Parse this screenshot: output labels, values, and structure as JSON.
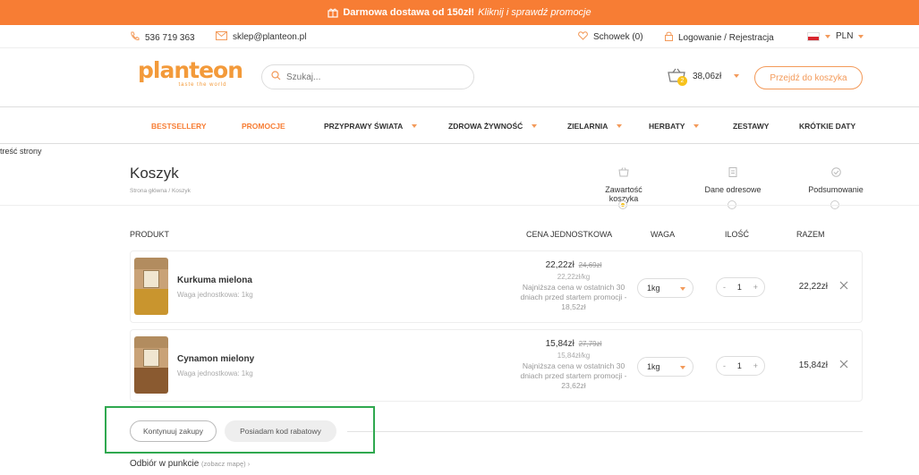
{
  "promo": {
    "bold": "Darmowa dostawa od 150zł!",
    "italic": "Kliknij i sprawdź promocje"
  },
  "contact": {
    "phone": "536 719 363",
    "email": "sklep@planteon.pl",
    "wishlist": "Schowek (0)",
    "login": "Logowanie / Rejestracja",
    "currency": "PLN"
  },
  "header": {
    "logo_word": "planteon",
    "logo_tag": "taste the world",
    "search_placeholder": "Szukaj...",
    "cart_count": "2",
    "cart_total": "38,06zł",
    "cart_button": "Przejdź do koszyka"
  },
  "nav": [
    {
      "label": "BESTSELLERY"
    },
    {
      "label": "PROMOCJE"
    },
    {
      "label": "PRZYPRAWY ŚWIATA"
    },
    {
      "label": "ZDROWA ŻYWNOŚĆ"
    },
    {
      "label": "ZIELARNIA"
    },
    {
      "label": "HERBATY"
    },
    {
      "label": "ZESTAWY"
    },
    {
      "label": "KRÓTKIE DATY"
    }
  ],
  "skip_text": "treść strony",
  "page": {
    "title": "Koszyk",
    "breadcrumb": "Strona główna  /  Koszyk"
  },
  "steps": [
    {
      "label": "Zawartość koszyka"
    },
    {
      "label": "Dane odresowe"
    },
    {
      "label": "Podsumowanie"
    }
  ],
  "columns": {
    "product": "PRODUKT",
    "unit_price": "CENA JEDNOSTKOWA",
    "weight": "WAGA",
    "qty": "ILOŚĆ",
    "total": "RAZEM"
  },
  "items": [
    {
      "name": "Kurkuma mielona",
      "unit_weight": "Waga jednostkowa: 1kg",
      "price": "22,22zł",
      "old_price": "24,69zł",
      "per_kg": "22,22zł/kg",
      "lowest": "Najniższa cena w ostatnich 30 dniach przed startem promocji - 18,52zł",
      "weight": "1kg",
      "qty": "1",
      "total": "22,22zł",
      "color": "#c9952e"
    },
    {
      "name": "Cynamon mielony",
      "unit_weight": "Waga jednostkowa: 1kg",
      "price": "15,84zł",
      "old_price": "27,79zł",
      "per_kg": "15,84zł/kg",
      "lowest": "Najniższa cena w ostatnich 30 dniach przed startem promocji - 23,62zł",
      "weight": "1kg",
      "qty": "1",
      "total": "15,84zł",
      "color": "#8a5a30"
    }
  ],
  "actions": {
    "continue": "Kontynuuj zakupy",
    "code": "Posiadam kod rabatowy"
  },
  "pickup": {
    "label": "Odbiór w punkcie",
    "map": "(zobacz mapę)"
  },
  "colors": {
    "accent": "#f77d34",
    "highlight": "#2fa84f"
  }
}
